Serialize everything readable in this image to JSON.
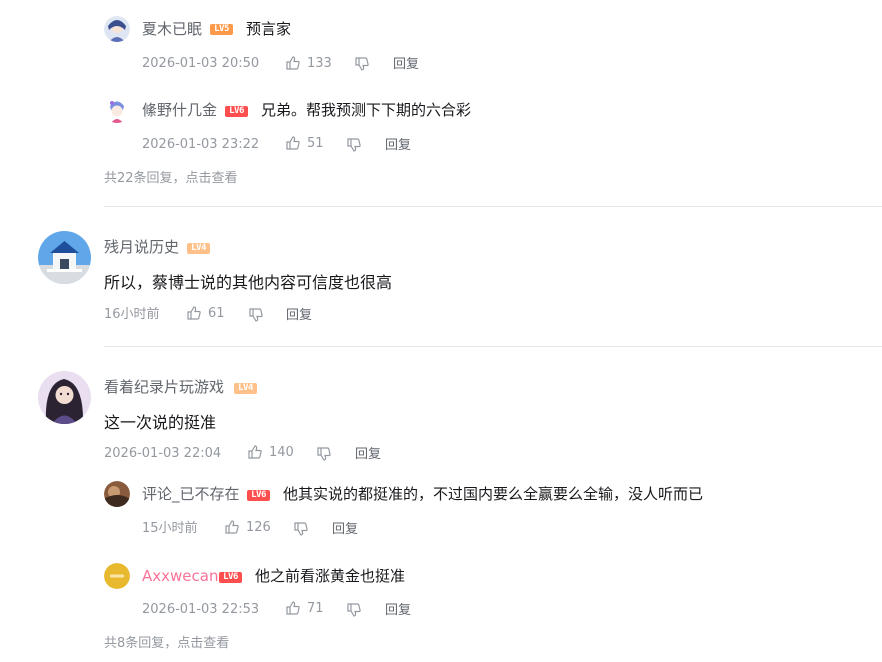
{
  "colors": {
    "text": "#18191c",
    "meta": "#9499a0",
    "username": "#61666d",
    "pink_username": "#fb7299",
    "lv4": "#ffc08a",
    "lv5": "#ff9a4b",
    "lv6": "#ff4e4e",
    "divider": "#e3e5e7"
  },
  "thread1": {
    "replies": [
      {
        "username": "夏木已眠",
        "level": "LV5",
        "text": "预言家",
        "time": "2026-01-03 20:50",
        "likes": "133",
        "reply_label": "回复"
      },
      {
        "username": "絛野什几金",
        "level": "LV6",
        "text": "兄弟。帮我预测下下期的六合彩",
        "time": "2026-01-03 23:22",
        "likes": "51",
        "reply_label": "回复"
      }
    ],
    "view_more": "共22条回复，点击查看"
  },
  "comment2": {
    "username": "残月说历史",
    "level": "LV4",
    "text": "所以，蔡博士说的其他内容可信度也很高",
    "time": "16小时前",
    "likes": "61",
    "reply_label": "回复"
  },
  "comment3": {
    "username": "看着纪录片玩游戏",
    "level": "LV4",
    "text": "这一次说的挺准",
    "time": "2026-01-03 22:04",
    "likes": "140",
    "reply_label": "回复",
    "replies": [
      {
        "username": "评论_已不存在",
        "level": "LV6",
        "text": "他其实说的都挺准的，不过国内要么全赢要么全输，没人听而已",
        "time": "15小时前",
        "likes": "126",
        "reply_label": "回复"
      },
      {
        "username": "Axxwecan",
        "level": "LV6",
        "text": "他之前看涨黄金也挺准",
        "time": "2026-01-03 22:53",
        "likes": "71",
        "reply_label": "回复"
      }
    ],
    "view_more": "共8条回复，点击查看"
  },
  "icons": {
    "like": "thumbs-up-icon",
    "dislike": "thumbs-down-icon"
  }
}
